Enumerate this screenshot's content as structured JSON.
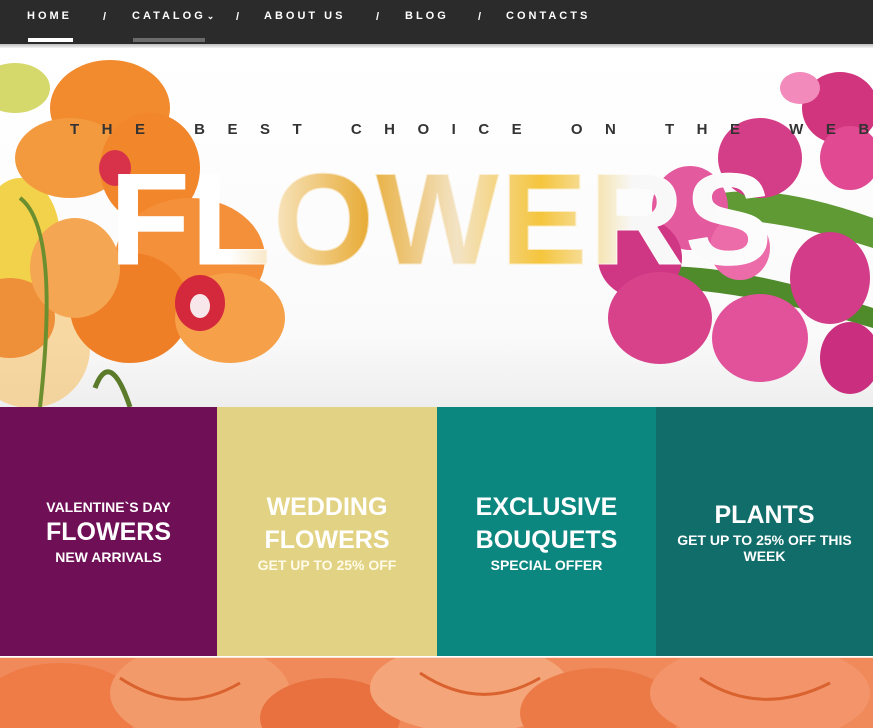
{
  "nav": {
    "items": [
      {
        "label": "HOME",
        "active": true
      },
      {
        "label": "CATALOG",
        "has_dropdown": true
      },
      {
        "label": "ABOUT US"
      },
      {
        "label": "BLOG"
      },
      {
        "label": "CONTACTS"
      }
    ],
    "separator": "/",
    "dropdown_icon": "chevron-down-icon"
  },
  "hero": {
    "tagline": "THE BEST CHOICE ON THE WEB",
    "headline": "FLOWERS"
  },
  "tiles": [
    {
      "line1": "VALENTINE`S DAY",
      "line2": "FLOWERS",
      "line3": "NEW ARRIVALS",
      "color": "#6f0f56"
    },
    {
      "line1": "WEDDING",
      "line2": "FLOWERS",
      "line3": "GET UP TO 25% OFF",
      "color": "#e2d284"
    },
    {
      "line1": "EXCLUSIVE",
      "line2": "BOUQUETS",
      "line3": "SPECIAL OFFER",
      "color": "#0c8780"
    },
    {
      "line1": "PLANTS",
      "line2": "GET UP TO 25% OFF THIS WEEK",
      "color": "#106d6a"
    }
  ],
  "colors": {
    "nav_bg": "#2b2b2b",
    "active_underline": "#ffffff",
    "hover_underline": "#6b6b6b"
  }
}
